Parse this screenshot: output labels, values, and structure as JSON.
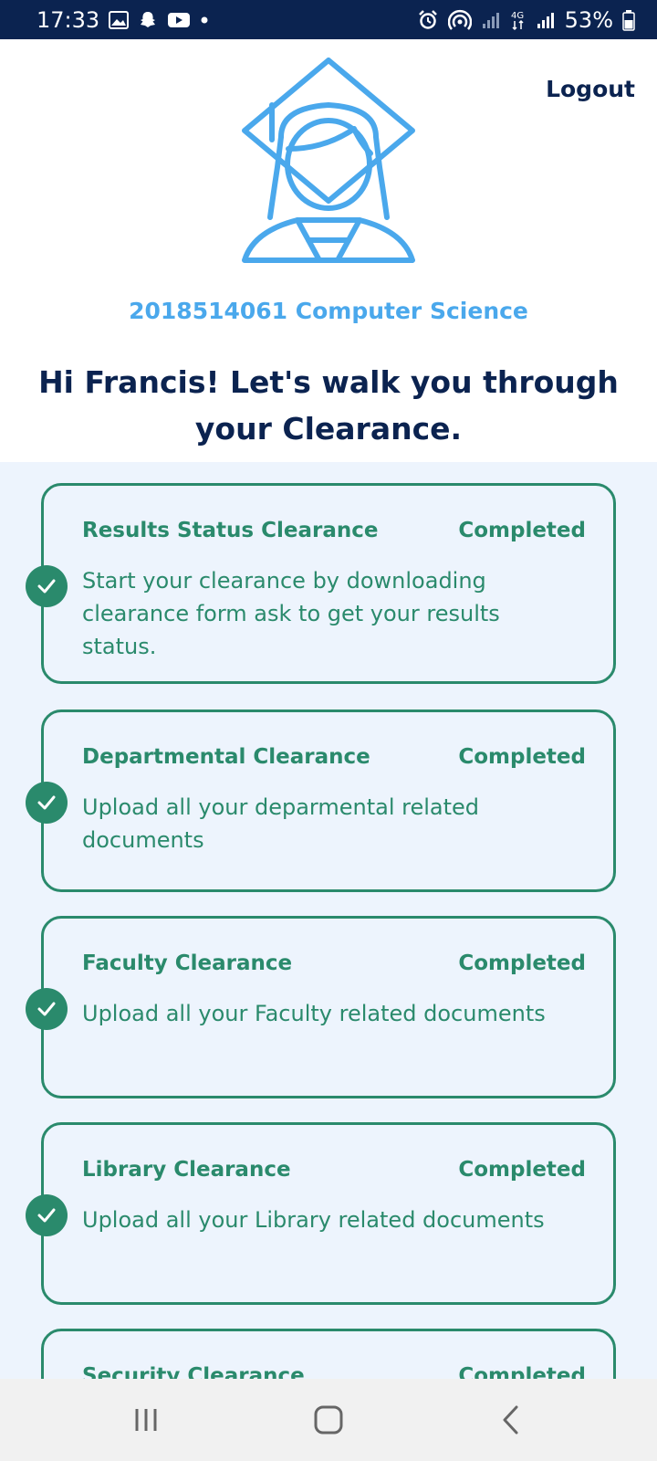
{
  "status_bar": {
    "time": "17:33",
    "battery": "53%",
    "left_icons": [
      "gallery-icon",
      "snapchat-icon",
      "youtube-icon",
      "dot-icon"
    ],
    "right_icons": [
      "alarm-icon",
      "hotspot-icon",
      "signal-icon",
      "4g-icon",
      "signal-icon",
      "battery-icon"
    ]
  },
  "header": {
    "logout_label": "Logout",
    "avatar_icon": "graduate-avatar-icon",
    "student_info": "2018514061 Computer Science",
    "greeting": "Hi Francis! Let's walk you through your Clearance."
  },
  "clearances": [
    {
      "title": "Results Status Clearance",
      "status": "Completed",
      "description": "Start your clearance by downloading clearance form ask to get your results status."
    },
    {
      "title": "Departmental Clearance",
      "status": "Completed",
      "description": "Upload all your deparmental related documents"
    },
    {
      "title": "Faculty Clearance",
      "status": "Completed",
      "description": "Upload all your Faculty related documents"
    },
    {
      "title": "Library Clearance",
      "status": "Completed",
      "description": "Upload all your Library related documents"
    },
    {
      "title": "Security Clearance",
      "status": "Completed",
      "description": ""
    }
  ],
  "colors": {
    "navy": "#0b2350",
    "accent_blue": "#4aa8ec",
    "green": "#2a8a6c",
    "list_bg": "#edf4fd"
  },
  "nav_bar": {
    "icons": [
      "recent-apps-icon",
      "home-icon",
      "back-icon"
    ]
  }
}
